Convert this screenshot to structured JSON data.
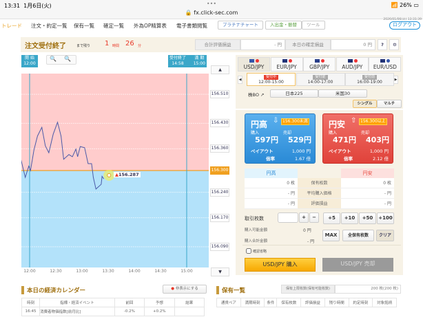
{
  "status": {
    "time": "13:31",
    "date": "1月6日(火)",
    "url": "fx.click-sec.com",
    "battery": "26%",
    "dots": "•••"
  },
  "nav": {
    "items": [
      "トレード",
      "注文・約定一覧",
      "保有一覧",
      "確定一覧",
      "外為OP精算表",
      "電子書類閲覧"
    ],
    "buttons": [
      "プラチナチャート",
      "入出金・振替",
      "ツール"
    ],
    "logout": "ログアウト",
    "clock": "2026/01/06(火) 13:31:39"
  },
  "order_bar": {
    "title": "注文受付終了",
    "remain_label": "まで残り",
    "hours": "1",
    "hours_unit": "時間",
    "minutes": "26",
    "minutes_unit": "分",
    "total_pl_label": "合計評価損益",
    "total_pl_value": "- 円",
    "today_pl_label": "本日の確定損益",
    "today_pl_value": "0 円",
    "help": "?",
    "gear": "⚙"
  },
  "chart": {
    "start_tag": [
      "開 始",
      "12:00"
    ],
    "end_tag": [
      "受付終了",
      "14:58"
    ],
    "expiry_tag": [
      "満 期",
      "15:00"
    ],
    "strike": "156.300",
    "current_price": "156.287",
    "current_arrow": "▲",
    "y_labels": [
      "156.510",
      "156.430",
      "156.360",
      "156.300",
      "156.240",
      "156.170",
      "156.090"
    ],
    "x_labels": [
      "12:00",
      "12:30",
      "13:00",
      "13:30",
      "14:00",
      "14:30",
      "15:00"
    ],
    "up_arrow": "▲",
    "down_arrow": "▼",
    "zoom_out": "−",
    "zoom_in": "+",
    "colors": {
      "above": "#ffcccc",
      "below": "#b3e2fa",
      "line": "#4a5aa8",
      "strike": "#f0a020"
    }
  },
  "chart_data": {
    "type": "line",
    "x_axis": "time",
    "strike": 156.3,
    "ylim": [
      156.03,
      156.58
    ],
    "series": [
      {
        "values": [
          [
            "11:50",
            156.331
          ],
          [
            "11:55",
            156.281
          ],
          [
            "11:59",
            156.312
          ],
          [
            "12:01",
            156.3
          ],
          [
            "12:05",
            156.357
          ],
          [
            "12:09",
            156.395
          ],
          [
            "12:14",
            156.419
          ],
          [
            "12:18",
            156.368
          ],
          [
            "12:22",
            156.349
          ],
          [
            "12:27",
            156.4
          ],
          [
            "12:32",
            156.433
          ],
          [
            "12:36",
            156.395
          ],
          [
            "12:39",
            156.331
          ],
          [
            "12:45",
            156.344
          ],
          [
            "12:49",
            156.338
          ],
          [
            "12:53",
            156.359
          ],
          [
            "12:55",
            156.338
          ],
          [
            "12:58",
            156.366
          ],
          [
            "13:03",
            156.363
          ],
          [
            "13:07",
            156.319
          ],
          [
            "13:11",
            156.319
          ],
          [
            "13:13",
            156.281
          ],
          [
            "13:16",
            156.249
          ],
          [
            "13:22",
            156.262
          ],
          [
            "13:23",
            156.284
          ],
          [
            "13:25",
            156.277
          ],
          [
            "13:31",
            156.287
          ]
        ]
      }
    ]
  },
  "pairs": [
    "USD/JPY",
    "EUR/JPY",
    "GBP/JPY",
    "AUD/JPY",
    "EUR/USD"
  ],
  "slots": [
    {
      "status": "受付中",
      "time": "12:00-15:00"
    },
    {
      "status": "受付前",
      "time": "14:00-17:00"
    },
    {
      "status": "受付前",
      "time": "16:00-19:00"
    }
  ],
  "stock_bo": {
    "label": "株BO ↗",
    "items": [
      "日本225",
      "米国30"
    ]
  },
  "mode": [
    "シングル",
    "マルチ"
  ],
  "high": {
    "title": "円高",
    "cond": "156.300未満",
    "buy_label": "購入",
    "buy": "597円",
    "sell_label": "売却",
    "sell": "529円",
    "payout_label": "ペイアウト",
    "payout": "1,000 円",
    "rate_label": "倍率",
    "rate": "1.67 倍",
    "color": "#3a9be0"
  },
  "low": {
    "title": "円安",
    "cond": "156.300以上",
    "buy_label": "購入",
    "buy": "471円",
    "sell_label": "売却",
    "sell": "403円",
    "payout_label": "ペイアウト",
    "payout": "1,000 円",
    "rate_label": "倍率",
    "rate": "2.12 倍",
    "color": "#e8483e"
  },
  "positions": {
    "rows": [
      {
        "label": "保有枚数",
        "high": "0 枚",
        "low": "0 枚"
      },
      {
        "label": "平均購入価格",
        "high": "- 円",
        "low": "- 円"
      },
      {
        "label": "評価損益",
        "high": "- 円",
        "low": "- 円"
      }
    ]
  },
  "trade": {
    "qty_label": "取引枚数",
    "qty_value": "",
    "plus": "+",
    "minus": "−",
    "quick": [
      "+5",
      "+10",
      "+50",
      "+100"
    ],
    "max": "MAX",
    "all": "全保有枚数",
    "clear": "クリア",
    "avail_label": "購入可能金額",
    "avail": "0 円",
    "total_label": "購入合計金額",
    "total": "- 円",
    "skip_confirm": "確認省略",
    "buy_btn": "USD/JPY 購入",
    "sell_btn": "USD/JPY 売却"
  },
  "calendar": {
    "title": "本日の経済カレンダー",
    "hide": "非表示にする",
    "headers": [
      "時刻",
      "指標・経済イベント",
      "前回",
      "予想",
      "結果"
    ],
    "rows": [
      {
        "time": "16:45",
        "event": "消費者物価指数[前月比]",
        "prev": "-0.2%",
        "fcst": "+0.2%",
        "result": ""
      }
    ]
  },
  "holdings": {
    "title": "保有一覧",
    "limit_label": "保有上限枚数(保有可能枚数)",
    "limit_value": "200 枚(200 枚)",
    "headers": [
      "通貨ペア",
      "満期時刻",
      "条件",
      "保有枚数",
      "評価損益",
      "残り時間",
      "約定時刻",
      "対象銘柄"
    ]
  }
}
